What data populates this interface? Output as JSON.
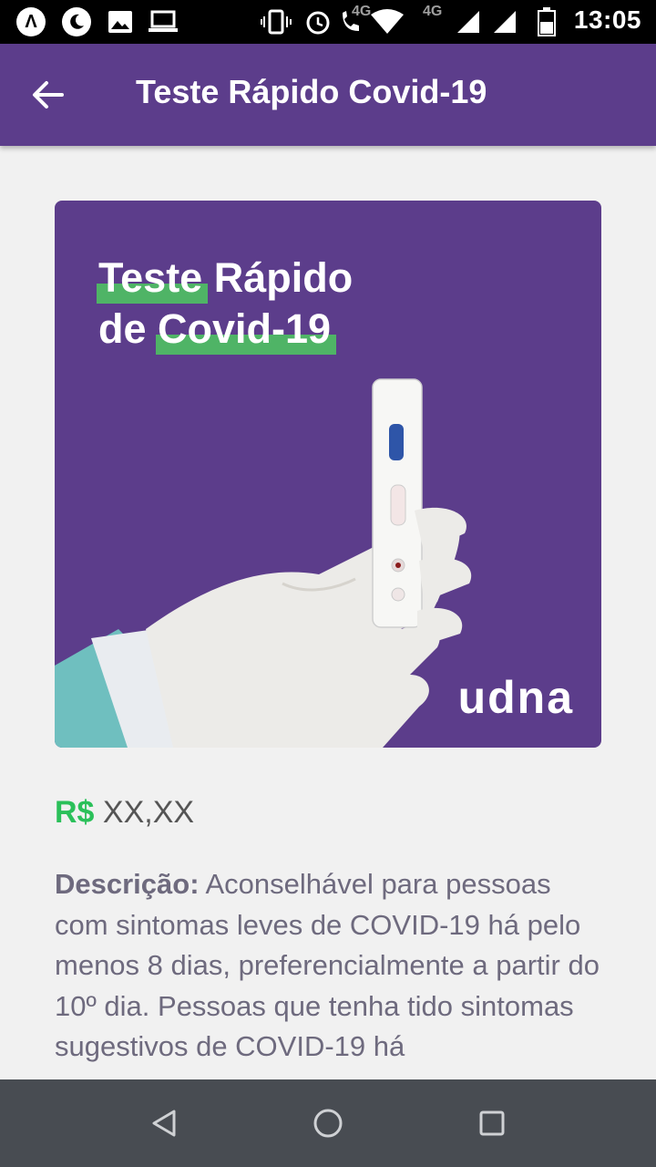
{
  "status_bar": {
    "time": "13:05",
    "network": "4G",
    "network_secondary": "4G",
    "left_icons": [
      "app-logo-icon",
      "night-mode-icon",
      "image-icon",
      "laptop-icon"
    ],
    "right_icons": [
      "vibrate-icon",
      "alarm-icon",
      "wifi-call-icon",
      "wifi-icon",
      "signal-icon",
      "signal-icon",
      "battery-icon"
    ]
  },
  "app_bar": {
    "title": "Teste Rápido Covid-19",
    "back_icon": "arrow-back-icon"
  },
  "banner": {
    "line1_highlight": "Teste",
    "line1_rest": " Rápido",
    "line2_lead": "de ",
    "line2_highlight": "Covid-19",
    "brand": "udna",
    "highlight_color": "#4fb466",
    "background_color": "#5c3d8b"
  },
  "product": {
    "currency": "R$",
    "price": "XX,XX",
    "description_label": "Descrição:",
    "description_text": "Aconselhável para pessoas com sintomas leves de COVID-19 há pelo menos 8 dias, preferencialmente a partir do 10º dia. Pessoas que tenha tido sintomas sugestivos de COVID-19 há"
  },
  "nav_bar": {
    "icons": [
      "back-triangle-icon",
      "home-circle-icon",
      "recents-square-icon"
    ]
  },
  "colors": {
    "primary": "#5c3d8b",
    "accent_green": "#2bc05a",
    "text_gray": "#6e6a7e",
    "nav_bar": "#484c52"
  }
}
